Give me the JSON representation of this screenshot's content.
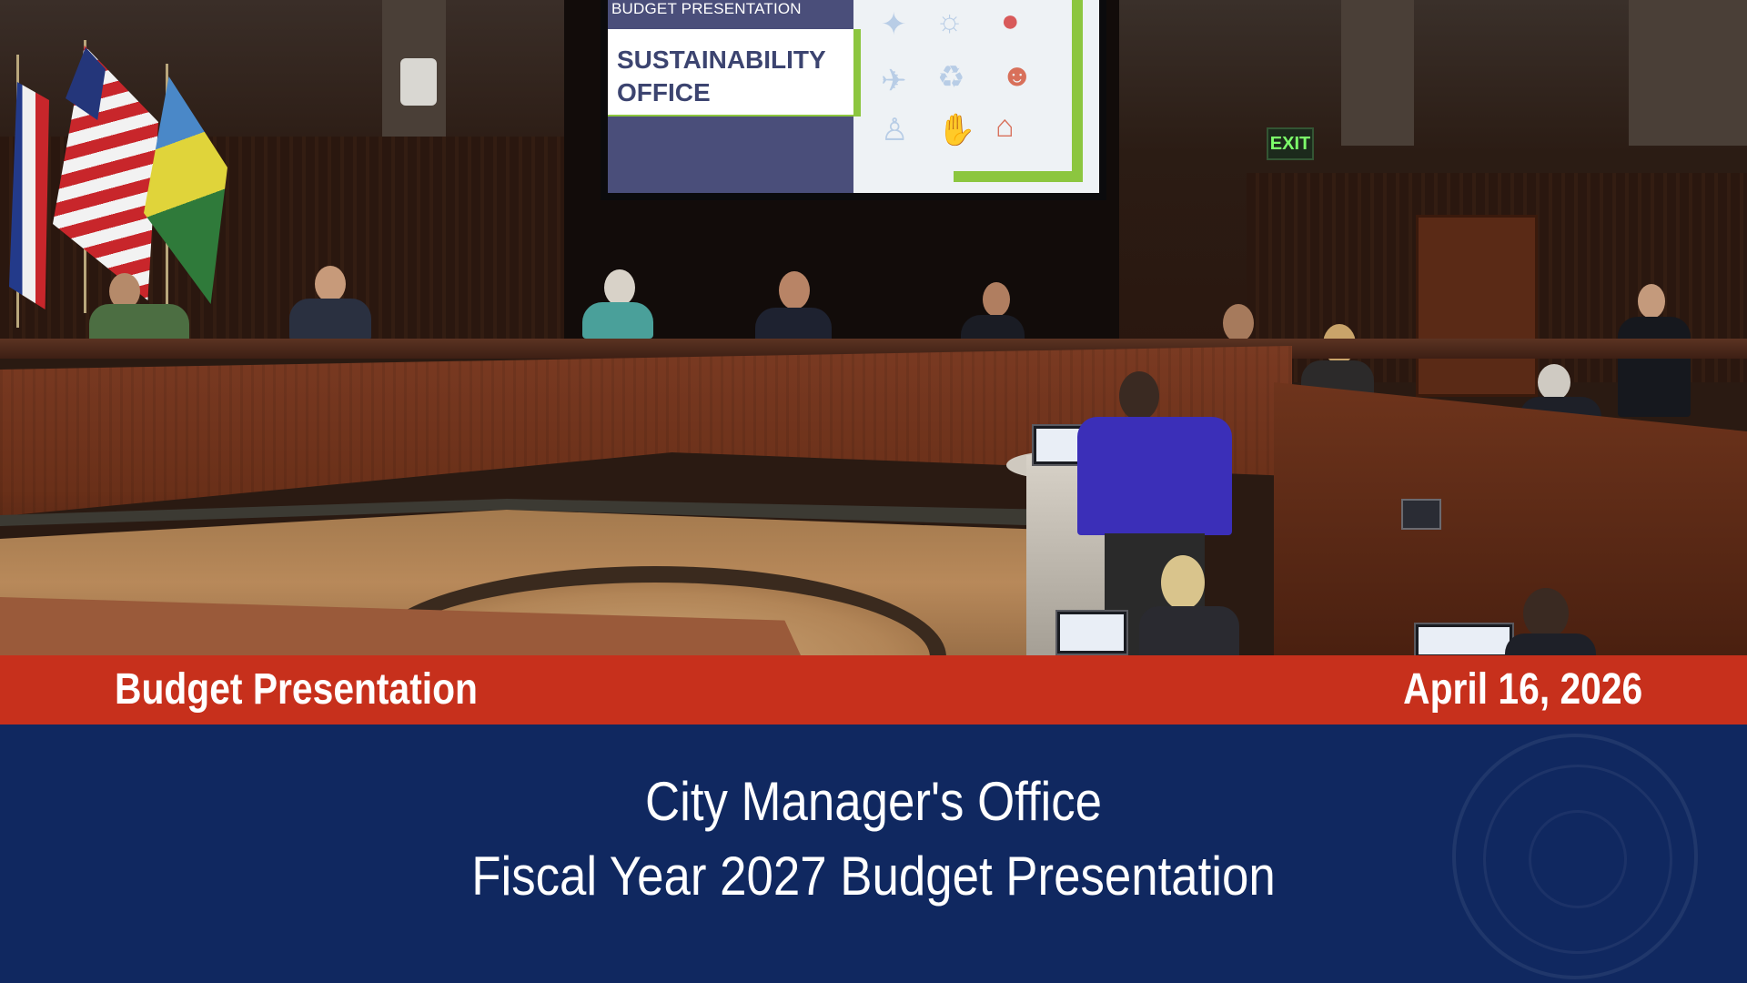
{
  "slide": {
    "header": "BUDGET PRESENTATION",
    "title_line1": "SUSTAINABILITY",
    "title_line2": "OFFICE"
  },
  "exit_sign": "EXIT",
  "lower_third": {
    "left_label": "Budget Presentation",
    "right_label": "April 16, 2026",
    "line1": "City Manager's Office",
    "line2": "Fiscal Year 2027 Budget Presentation"
  },
  "colors": {
    "red_bar": "#c7301c",
    "blue_bar": "#102860",
    "slide_green": "#8cc63f",
    "slide_navy": "#3c4470"
  }
}
